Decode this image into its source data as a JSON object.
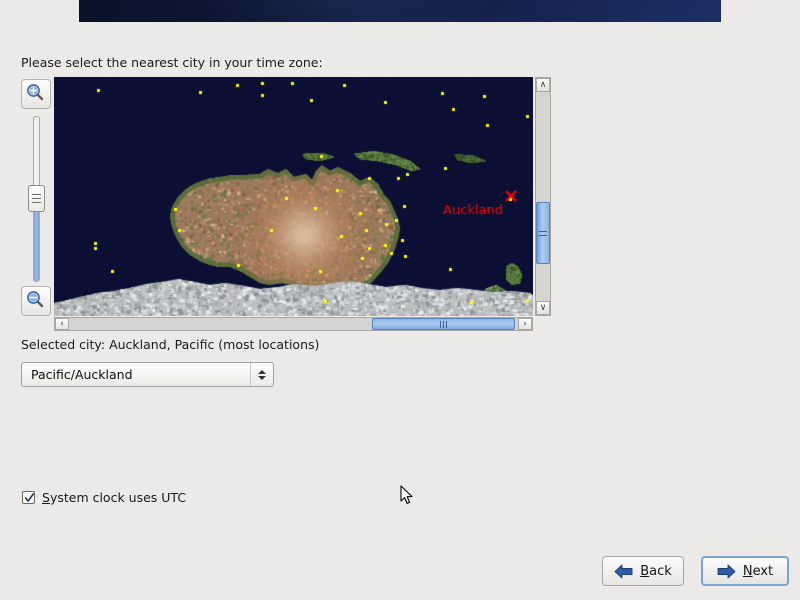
{
  "window": {
    "banner_accent_dark": "#0a1228",
    "banner_accent_light": "#1c2f63",
    "background": "#ebeae8"
  },
  "prompt": {
    "label": "Please select the nearest city in your time zone:"
  },
  "map": {
    "ocean_color": "#0a0f33",
    "city_marker_color": "#ffff00",
    "selection_color": "#ff0000",
    "selected_marker_label": "Auckland",
    "selected_marker_glyph": "X",
    "zoom_in_icon": "magnifier-plus-icon",
    "zoom_out_icon": "magnifier-minus-icon",
    "zoom_slider_value": 42,
    "vertical_scroll_percent": 52,
    "horizontal_scroll_percent": 69,
    "scroll_up_glyph": "∧",
    "scroll_down_glyph": "∨",
    "scroll_left_glyph": "‹",
    "scroll_right_glyph": "›"
  },
  "selection": {
    "status_prefix": "Selected city:",
    "status_text": "Selected city: Auckland, Pacific (most locations)",
    "timezone_value": "Pacific/Auckland",
    "timezone_options": [
      "Pacific/Auckland"
    ]
  },
  "options": {
    "utc_checkbox_checked": true,
    "utc_label_mnemonic": "S",
    "utc_label_rest": "ystem clock uses UTC"
  },
  "footer": {
    "back_mnemonic": "B",
    "back_rest": "ack",
    "next_mnemonic": "N",
    "next_rest": "ext",
    "back_icon": "arrow-left-icon",
    "next_icon": "arrow-right-icon"
  }
}
